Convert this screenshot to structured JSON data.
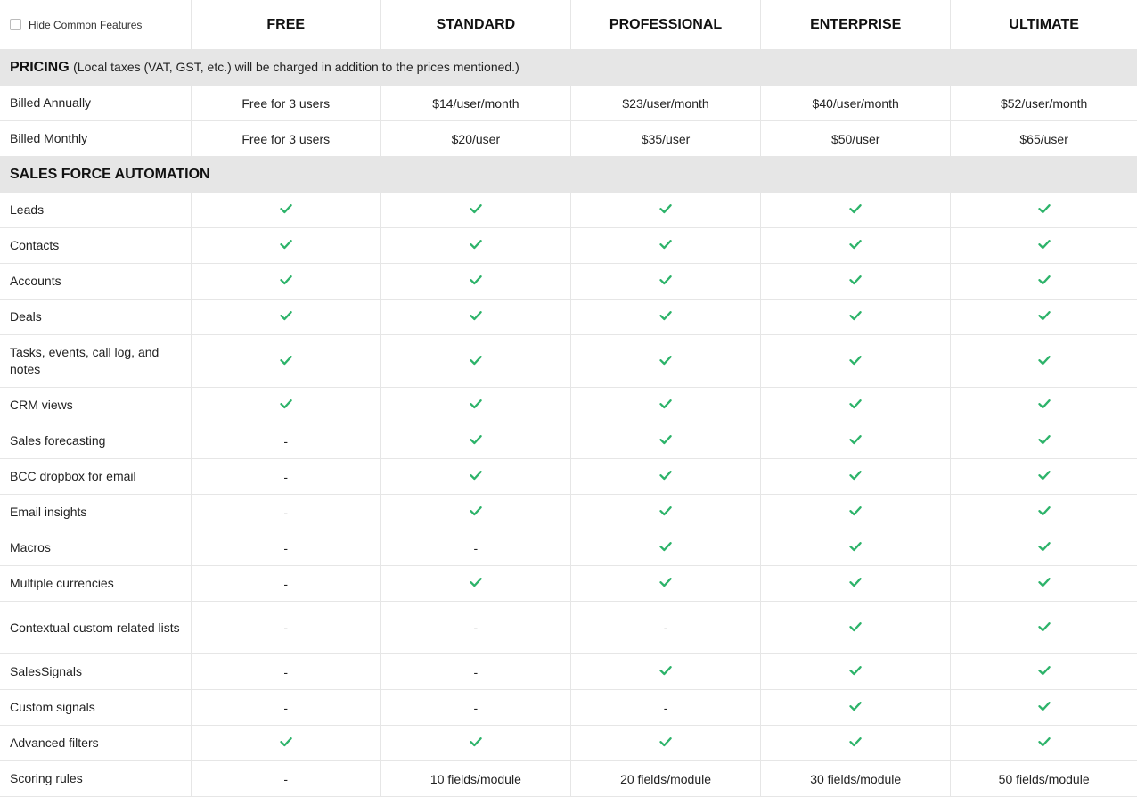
{
  "header": {
    "hide_common_label": "Hide Common Features",
    "plans": [
      "FREE",
      "STANDARD",
      "PROFESSIONAL",
      "ENTERPRISE",
      "ULTIMATE"
    ]
  },
  "colors": {
    "check": "#2db36a",
    "section_bg": "#e6e6e6",
    "border": "#e6e6e6"
  },
  "pricing": {
    "title": "PRICING",
    "note": "(Local taxes (VAT, GST, etc.) will be charged in addition to the prices mentioned.)",
    "rows": [
      {
        "label": "Billed Annually",
        "values": [
          "Free for 3 users",
          "$14/user/month",
          "$23/user/month",
          "$40/user/month",
          "$52/user/month"
        ]
      },
      {
        "label": "Billed Monthly",
        "values": [
          "Free for 3 users",
          "$20/user",
          "$35/user",
          "$50/user",
          "$65/user"
        ]
      }
    ]
  },
  "sfa": {
    "title": "SALES FORCE AUTOMATION",
    "rows": [
      {
        "label": "Leads",
        "values": [
          "check",
          "check",
          "check",
          "check",
          "check"
        ]
      },
      {
        "label": "Contacts",
        "values": [
          "check",
          "check",
          "check",
          "check",
          "check"
        ]
      },
      {
        "label": "Accounts",
        "values": [
          "check",
          "check",
          "check",
          "check",
          "check"
        ]
      },
      {
        "label": "Deals",
        "values": [
          "check",
          "check",
          "check",
          "check",
          "check"
        ]
      },
      {
        "label": "Tasks, events, call log, and notes",
        "values": [
          "check",
          "check",
          "check",
          "check",
          "check"
        ]
      },
      {
        "label": "CRM views",
        "values": [
          "check",
          "check",
          "check",
          "check",
          "check"
        ]
      },
      {
        "label": "Sales forecasting",
        "values": [
          "-",
          "check",
          "check",
          "check",
          "check"
        ]
      },
      {
        "label": "BCC dropbox for email",
        "values": [
          "-",
          "check",
          "check",
          "check",
          "check"
        ]
      },
      {
        "label": "Email insights",
        "values": [
          "-",
          "check",
          "check",
          "check",
          "check"
        ]
      },
      {
        "label": "Macros",
        "values": [
          "-",
          "-",
          "check",
          "check",
          "check"
        ]
      },
      {
        "label": "Multiple currencies",
        "values": [
          "-",
          "check",
          "check",
          "check",
          "check"
        ]
      },
      {
        "label": "Contextual custom related lists",
        "values": [
          "-",
          "-",
          "-",
          "check",
          "check"
        ]
      },
      {
        "label": "SalesSignals",
        "values": [
          "-",
          "-",
          "check",
          "check",
          "check"
        ]
      },
      {
        "label": "Custom signals",
        "values": [
          "-",
          "-",
          "-",
          "check",
          "check"
        ]
      },
      {
        "label": "Advanced filters",
        "values": [
          "check",
          "check",
          "check",
          "check",
          "check"
        ]
      },
      {
        "label": "Scoring rules",
        "values": [
          "-",
          "10 fields/module",
          "20 fields/module",
          "30 fields/module",
          "50 fields/module"
        ]
      }
    ]
  }
}
